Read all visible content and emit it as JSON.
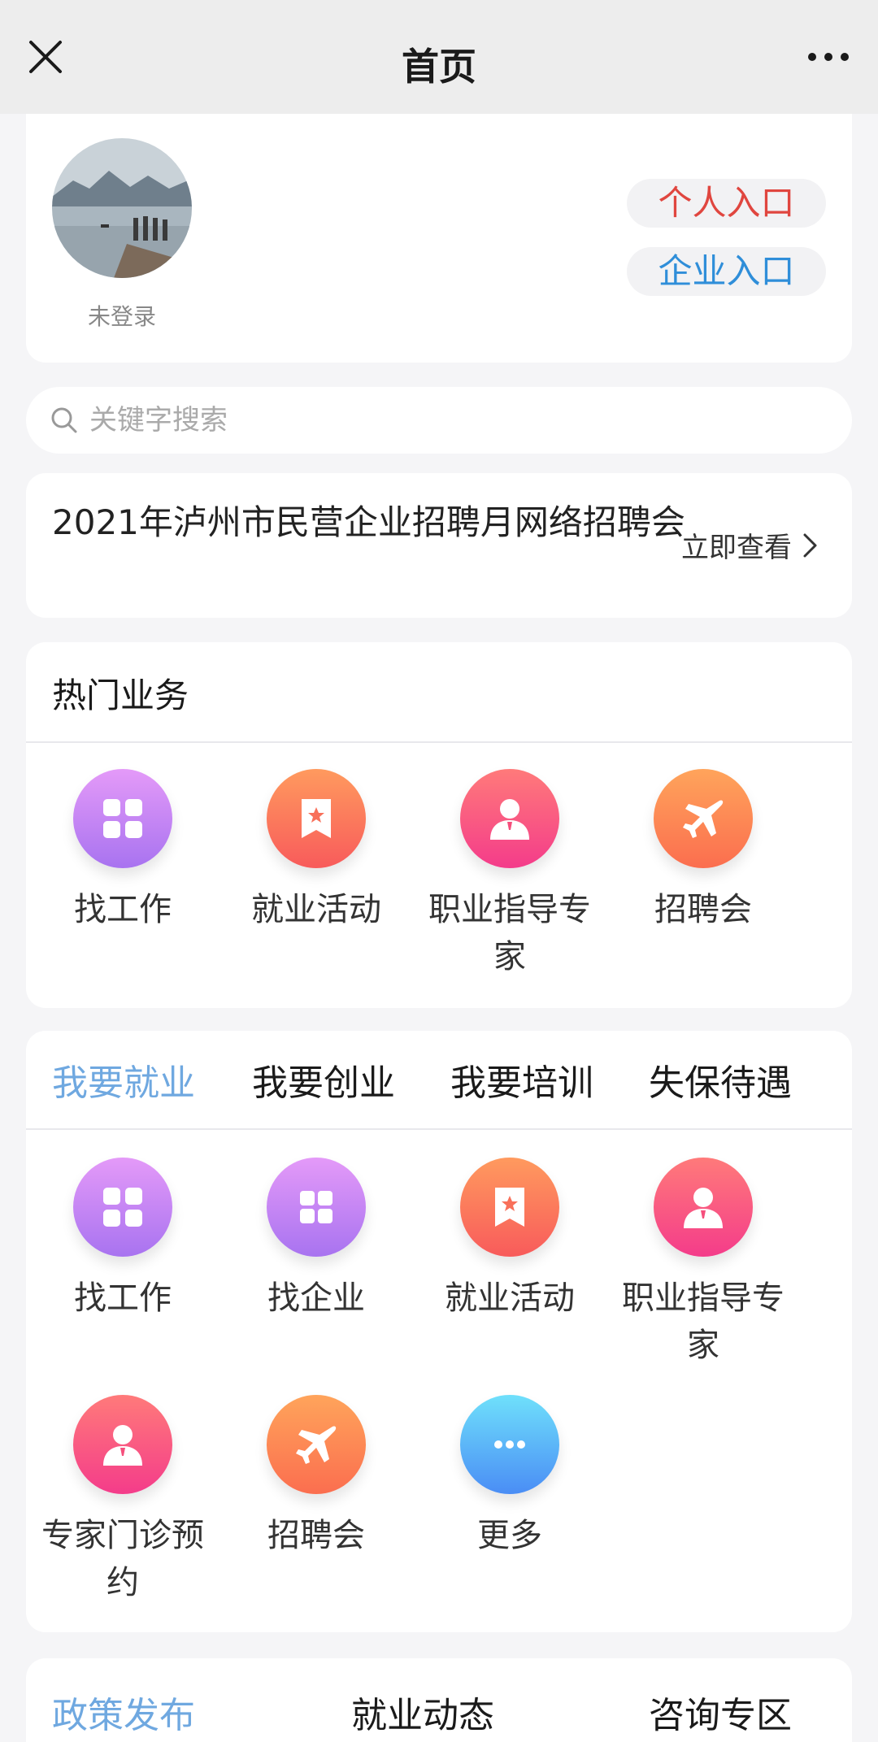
{
  "header": {
    "title": "首页"
  },
  "user": {
    "login_status": "未登录",
    "personal_entry": "个人入口",
    "company_entry": "企业入口"
  },
  "search": {
    "placeholder": "关键字搜索"
  },
  "banner": {
    "title": "2021年泸州市民营企业招聘月网络招聘会",
    "link": "立即查看"
  },
  "hot": {
    "title": "热门业务",
    "items": [
      {
        "label": "找工作",
        "icon": "grid-icon"
      },
      {
        "label": "就业活动",
        "icon": "bookmark-star-icon"
      },
      {
        "label": "职业指导专家",
        "icon": "person-icon"
      },
      {
        "label": "招聘会",
        "icon": "plane-icon"
      }
    ]
  },
  "employment": {
    "tabs": [
      "我要就业",
      "我要创业",
      "我要培训",
      "失保待遇"
    ],
    "active_tab": "我要就业",
    "items": [
      {
        "label": "找工作",
        "icon": "grid-icon"
      },
      {
        "label": "找企业",
        "icon": "grid-icon"
      },
      {
        "label": "就业活动",
        "icon": "bookmark-star-icon"
      },
      {
        "label": "职业指导专家",
        "icon": "person-icon"
      },
      {
        "label": "专家门诊预约",
        "icon": "person-icon"
      },
      {
        "label": "招聘会",
        "icon": "plane-icon"
      },
      {
        "label": "更多",
        "icon": "more-icon"
      }
    ]
  },
  "bottom_tabs": {
    "tabs": [
      "政策发布",
      "就业动态",
      "咨询专区"
    ],
    "active_tab": "政策发布"
  },
  "colors": {
    "accent_blue": "#6fa8e0",
    "personal_red": "#e0463f",
    "company_blue": "#2f8ed9"
  }
}
